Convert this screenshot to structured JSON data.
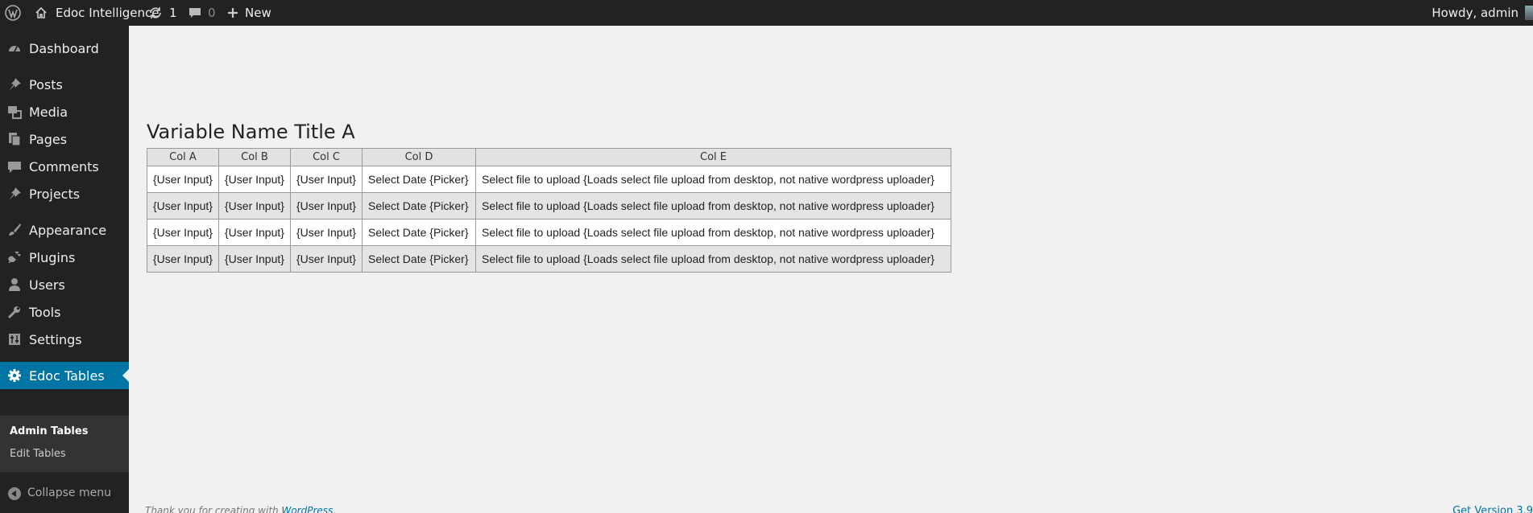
{
  "adminbar": {
    "site_name": "Edoc Intelligence",
    "updates_count": "1",
    "comments_count": "0",
    "new_label": "New",
    "howdy": "Howdy, admin"
  },
  "sidebar": {
    "items": [
      {
        "label": "Dashboard",
        "icon": "dashboard-icon"
      },
      {
        "label": "Posts",
        "icon": "pin-icon"
      },
      {
        "label": "Media",
        "icon": "media-icon"
      },
      {
        "label": "Pages",
        "icon": "pages-icon"
      },
      {
        "label": "Comments",
        "icon": "comment-icon"
      },
      {
        "label": "Projects",
        "icon": "pin-icon"
      },
      {
        "label": "Appearance",
        "icon": "brush-icon"
      },
      {
        "label": "Plugins",
        "icon": "plug-icon"
      },
      {
        "label": "Users",
        "icon": "user-icon"
      },
      {
        "label": "Tools",
        "icon": "wrench-icon"
      },
      {
        "label": "Settings",
        "icon": "settings-icon"
      },
      {
        "label": "Edoc Tables",
        "icon": "gear-icon"
      }
    ],
    "submenu": [
      "Admin Tables",
      "Edit Tables"
    ],
    "collapse_label": "Collapse menu"
  },
  "main": {
    "title": "Variable Name Title A",
    "table": {
      "headers": [
        "Col A",
        "Col B",
        "Col C",
        "Col D",
        "Col E"
      ],
      "rows": [
        [
          "{User Input}",
          "{User Input}",
          "{User Input}",
          "Select Date {Picker}",
          "Select file to upload {Loads select file upload from desktop, not native wordpress uploader}"
        ],
        [
          "{User Input}",
          "{User Input}",
          "{User Input}",
          "Select Date {Picker}",
          "Select file to upload {Loads select file upload from desktop, not native wordpress uploader}"
        ],
        [
          "{User Input}",
          "{User Input}",
          "{User Input}",
          "Select Date {Picker}",
          "Select file to upload {Loads select file upload from desktop, not native wordpress uploader}"
        ],
        [
          "{User Input}",
          "{User Input}",
          "{User Input}",
          "Select Date {Picker}",
          "Select file to upload {Loads select file upload from desktop, not native wordpress uploader}"
        ]
      ]
    }
  },
  "footer": {
    "thanks_prefix": "Thank you for creating with ",
    "thanks_link": "WordPress",
    "thanks_suffix": ".",
    "version": "Get Version 3.9"
  },
  "colors": {
    "adminbar_bg": "#222222",
    "sidebar_bg": "#222222",
    "accent": "#0074a2",
    "content_bg": "#f1f1f1"
  }
}
